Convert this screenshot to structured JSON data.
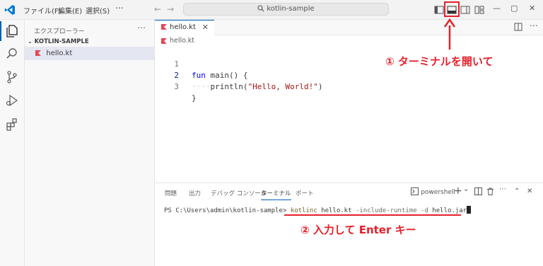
{
  "titlebar": {
    "menu": [
      "ファイル(F)",
      "編集(E)",
      "選択(S)",
      "⋯"
    ],
    "search_text": "kotlin-sample",
    "window_controls": [
      "—",
      "▢",
      "✕"
    ]
  },
  "sidebar": {
    "title": "エクスプローラー",
    "more": "⋯",
    "folder": "KOTLIN-SAMPLE",
    "file": "hello.kt"
  },
  "editor": {
    "tab_label": "hello.kt",
    "tab_close": "✕",
    "breadcrumb": "hello.kt",
    "lines": [
      "1",
      "2",
      "3"
    ],
    "code": {
      "l1_kw": "fun",
      "l1_rest": " main() {",
      "l2_indent": "····",
      "l2_fn": "println(",
      "l2_str": "\"Hello, World!\"",
      "l2_end": ")",
      "l3": "}"
    }
  },
  "panel": {
    "tabs": [
      "問題",
      "出力",
      "デバッグ コンソール",
      "ターミナル",
      "ポート"
    ],
    "active_tab": 3,
    "shell": "powershell",
    "controls": [
      "+",
      "⌄",
      "⋯",
      "⌃",
      "✕"
    ],
    "prompt": "PS C:\\Users\\admin\\kotlin-sample> ",
    "cmd_kw": "kotlinc",
    "cmd_file": " hello.kt ",
    "cmd_flag": "-include-runtime -d",
    "cmd_out": " hello.jar"
  },
  "annotations": {
    "step1": "① ターミナルを開いて",
    "step2": "② 入力して Enter キー"
  },
  "colors": {
    "accent": "#005fb8",
    "annotation": "#e8202a"
  }
}
